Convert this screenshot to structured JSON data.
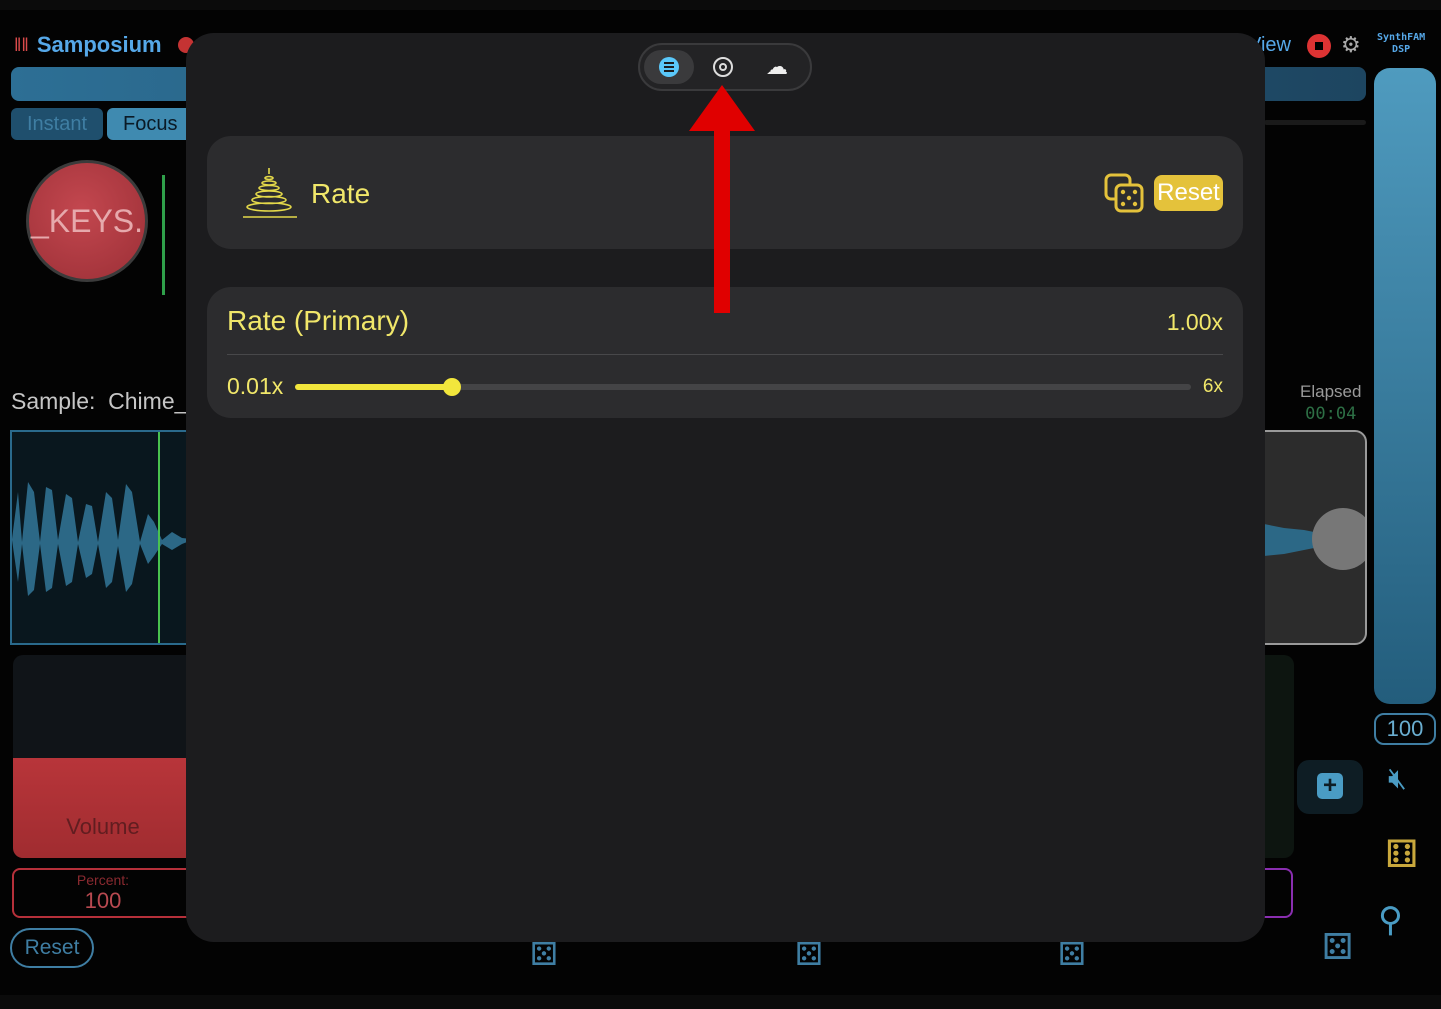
{
  "app": {
    "title": "Samposium",
    "view_label": "View",
    "brand_line1": "SynthFAM",
    "brand_line2": "DSP"
  },
  "mode_tabs": [
    {
      "label": "Instant"
    },
    {
      "label": "Focus"
    }
  ],
  "knob": {
    "label": "_KEYS."
  },
  "sample": {
    "label": "Sample:",
    "name": "Chime_"
  },
  "elapsed": {
    "label": "Elapsed",
    "value": "00:04"
  },
  "volume": {
    "label": "Volume",
    "percent_label": "Percent:",
    "percent_value": "100"
  },
  "background_reset_label": "Reset",
  "side_slider_value": "100",
  "modal": {
    "segments": [
      {
        "icon": "list-icon",
        "selected": true
      },
      {
        "icon": "gear-icon",
        "selected": false
      },
      {
        "icon": "tree-icon",
        "selected": false
      }
    ],
    "header": {
      "title": "Rate",
      "icon": "rate-cone-icon",
      "random_icon": "dice-icon",
      "reset_label": "Reset"
    },
    "parameter": {
      "title": "Rate (Primary)",
      "value": "1.00x",
      "min_label": "0.01x",
      "max_label": "6x",
      "slider_fraction": 0.175
    }
  },
  "colors": {
    "accent_yellow": "#f1e76a",
    "reset_yellow": "#e4c23b",
    "app_blue": "#56a8e8",
    "annotation_red": "#e00000",
    "selected_segment_blue": "#5ac8fa"
  }
}
